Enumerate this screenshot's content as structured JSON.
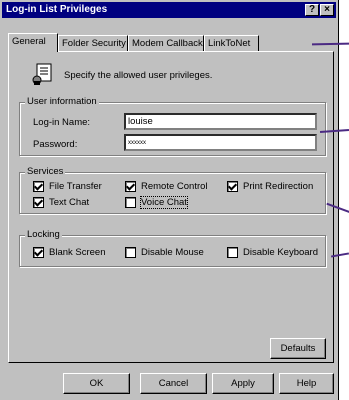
{
  "window": {
    "title": "Log-in List Privileges",
    "help_glyph": "?",
    "close_glyph": "×"
  },
  "tabs": [
    {
      "label": "General"
    },
    {
      "label": "Folder Security"
    },
    {
      "label": "Modem Callback"
    },
    {
      "label": "LinkToNet"
    }
  ],
  "intro": {
    "text": "Specify the allowed user privileges.",
    "icon": "privileges-icon"
  },
  "user_info": {
    "title": "User information",
    "login_label": "Log-in Name:",
    "login_value": "louise",
    "password_label": "Password:",
    "password_value": "xxxxxx"
  },
  "services": {
    "title": "Services",
    "items": [
      {
        "label": "File Transfer",
        "checked": true
      },
      {
        "label": "Remote Control",
        "checked": true
      },
      {
        "label": "Print Redirection",
        "checked": true
      },
      {
        "label": "Text Chat",
        "checked": true
      },
      {
        "label": "Voice Chat",
        "checked": false
      }
    ]
  },
  "locking": {
    "title": "Locking",
    "items": [
      {
        "label": "Blank Screen",
        "checked": true
      },
      {
        "label": "Disable Mouse",
        "checked": false
      },
      {
        "label": "Disable Keyboard",
        "checked": false
      }
    ]
  },
  "defaults_button": "Defaults",
  "buttons": {
    "ok": "OK",
    "cancel": "Cancel",
    "apply": "Apply",
    "help": "Help"
  },
  "colors": {
    "pointer": "#4b2a83",
    "titlebar": "#000080"
  }
}
